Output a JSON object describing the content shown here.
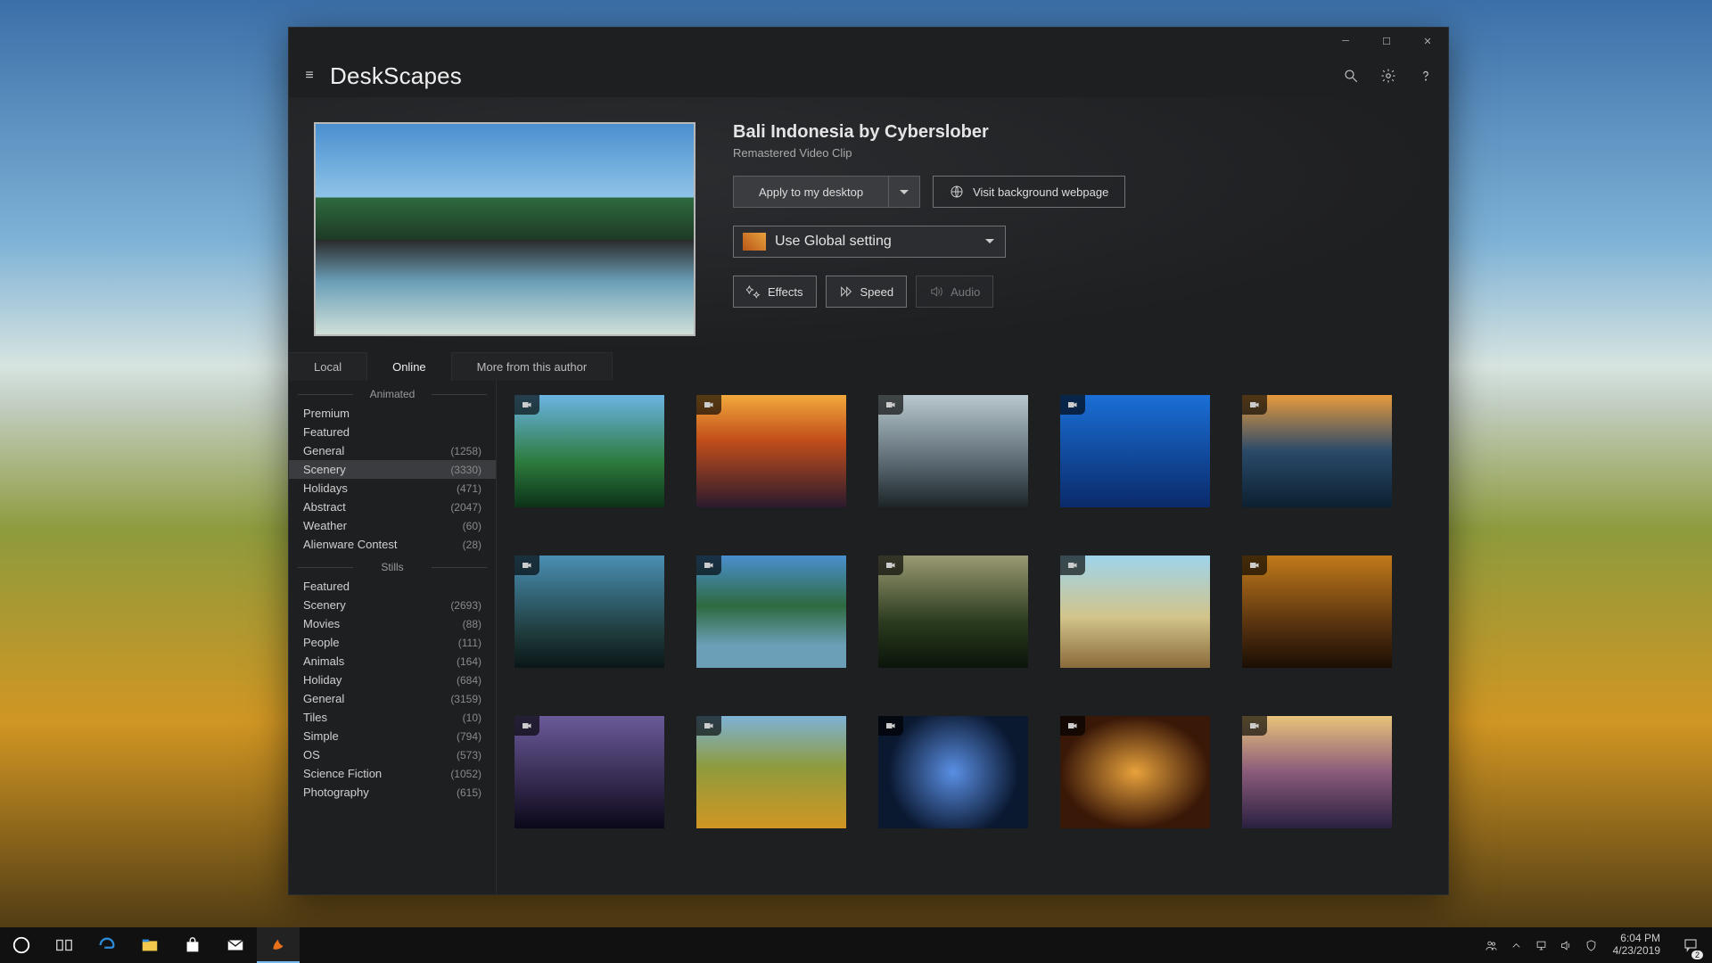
{
  "app": {
    "title": "DeskScapes"
  },
  "detail": {
    "title": "Bali Indonesia by Cyberslober",
    "subtitle": "Remastered Video Clip",
    "apply_label": "Apply to my desktop",
    "visit_label": "Visit background webpage",
    "global_label": "Use Global setting",
    "effects_label": "Effects",
    "speed_label": "Speed",
    "audio_label": "Audio"
  },
  "tabs": {
    "local": "Local",
    "online": "Online",
    "more": "More from this author",
    "active": "online"
  },
  "sidebar": {
    "section_animated": "Animated",
    "section_stills": "Stills",
    "animated": [
      {
        "label": "Premium",
        "count": ""
      },
      {
        "label": "Featured",
        "count": ""
      },
      {
        "label": "General",
        "count": "(1258)"
      },
      {
        "label": "Scenery",
        "count": "(3330)",
        "selected": true
      },
      {
        "label": "Holidays",
        "count": "(471)"
      },
      {
        "label": "Abstract",
        "count": "(2047)"
      },
      {
        "label": "Weather",
        "count": "(60)"
      },
      {
        "label": "Alienware Contest",
        "count": "(28)"
      }
    ],
    "stills": [
      {
        "label": "Featured",
        "count": ""
      },
      {
        "label": "Scenery",
        "count": "(2693)"
      },
      {
        "label": "Movies",
        "count": "(88)"
      },
      {
        "label": "People",
        "count": "(111)"
      },
      {
        "label": "Animals",
        "count": "(164)"
      },
      {
        "label": "Holiday",
        "count": "(684)"
      },
      {
        "label": "General",
        "count": "(3159)"
      },
      {
        "label": "Tiles",
        "count": "(10)"
      },
      {
        "label": "Simple",
        "count": "(794)"
      },
      {
        "label": "OS",
        "count": "(573)"
      },
      {
        "label": "Science Fiction",
        "count": "(1052)"
      },
      {
        "label": "Photography",
        "count": "(615)"
      }
    ]
  },
  "taskbar": {
    "time": "6:04 PM",
    "date": "4/23/2019",
    "notif_count": "2"
  }
}
